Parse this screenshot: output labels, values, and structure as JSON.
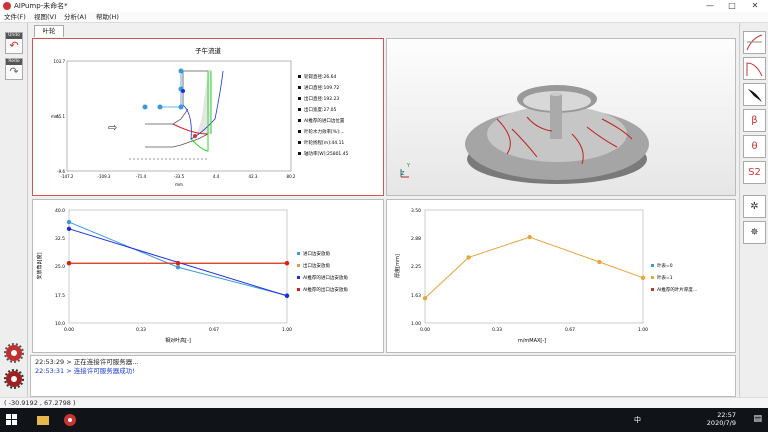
{
  "window": {
    "title": "AIPump-未命名*",
    "min": "—",
    "max": "□",
    "close": "✕"
  },
  "menu": [
    "文件(F)",
    "视图(V)",
    "分析(A)",
    "帮助(H)"
  ],
  "left_toolbar": [
    {
      "label": "Undo",
      "icon": "undo-arrow-icon"
    },
    {
      "label": "Redo",
      "icon": "redo-arrow-icon"
    }
  ],
  "tab": "叶轮",
  "meridional": {
    "title": "子午流道",
    "y_ticks": [
      "103.7",
      "45.1",
      "-9.6"
    ],
    "x_ticks": [
      "-147.2",
      "-109.3",
      "-71.4",
      "-33.5",
      "4.4",
      "42.3",
      "80.2"
    ],
    "y_axis_label": "mm",
    "x_axis_label": "mm",
    "params": [
      "轮毂直径:26.64",
      "进口直径:109.72",
      "出口直径:192.23",
      "出口宽度:27.05",
      "AI推荐的进口边位置",
      "叶轮水力效率[%]:...",
      "叶轮扬程[m]:44.11",
      "轴功率[W]:25801.45"
    ]
  },
  "view3d": {
    "axis_y": "Y",
    "axis_z": "Z"
  },
  "angle_chart": {
    "ylabel": "安放角β[度]",
    "xlabel": "相对叶高[-]",
    "y_ticks": [
      "40.0",
      "32.5",
      "25.0",
      "17.5",
      "10.0"
    ],
    "x_ticks": [
      "0.00",
      "0.33",
      "0.67",
      "1.00"
    ],
    "legend": [
      "进口边安放角",
      "出口边安放角",
      "AI推荐的进口边安放角",
      "AI推荐的出口边安放角"
    ]
  },
  "thick_chart": {
    "ylabel": "厚度[mm]",
    "xlabel": "m/mMAX[-]",
    "y_ticks": [
      "3.50",
      "2.88",
      "2.25",
      "1.63",
      "1.00"
    ],
    "x_ticks": [
      "0.00",
      "0.33",
      "0.67",
      "1.00"
    ],
    "legend": [
      "叶表=0",
      "叶表=1",
      "AI推荐的叶片厚度..."
    ]
  },
  "chart_data": [
    {
      "type": "line",
      "ylim": [
        10,
        40
      ],
      "xlim": [
        0,
        1
      ],
      "series": [
        {
          "name": "进口边安放角",
          "color": "#3a9ad9",
          "x": [
            0,
            0.5,
            1
          ],
          "y": [
            36.8,
            24.8,
            17.3
          ]
        },
        {
          "name": "出口边安放角",
          "color": "#e0a030",
          "x": [
            0,
            0.5,
            1
          ],
          "y": [
            25.8,
            25.8,
            25.8
          ]
        },
        {
          "name": "AI推荐的进口边安放角",
          "color": "#1b2fd6",
          "x": [
            0,
            1
          ],
          "y": [
            35,
            17.2
          ]
        },
        {
          "name": "AI推荐的出口边安放角",
          "color": "#d62020",
          "x": [
            0,
            0.5,
            1
          ],
          "y": [
            25.9,
            25.9,
            25.9
          ]
        }
      ]
    },
    {
      "type": "line",
      "ylim": [
        1,
        3.5
      ],
      "xlim": [
        0,
        1
      ],
      "series": [
        {
          "name": "叶表=1",
          "color": "#e8a53a",
          "x": [
            0,
            0.2,
            0.48,
            0.8,
            1
          ],
          "y": [
            1.55,
            2.45,
            2.9,
            2.35,
            2.0
          ]
        }
      ]
    }
  ],
  "right_toolbar": [
    "",
    "",
    "",
    "β",
    "θ",
    "S2",
    "",
    "",
    ""
  ],
  "log": [
    {
      "time": "22:53:29",
      "text": "> 正在连接许可服务器...",
      "ok": false
    },
    {
      "time": "22:53:31",
      "text": "> 连接许可服务器成功!",
      "ok": true
    }
  ],
  "status": "( -30.9192 , 67.2798 )",
  "taskbar": {
    "time": "22:57",
    "date": "2020/7/9",
    "ime": "中"
  }
}
